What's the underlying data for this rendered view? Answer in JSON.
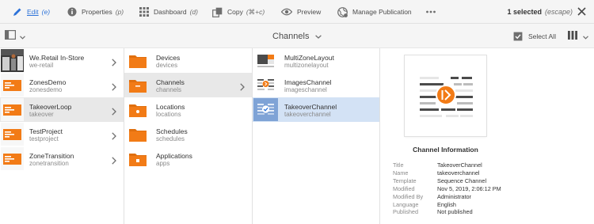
{
  "toolbar": {
    "edit": {
      "label": "Edit",
      "shortcut": "(e)"
    },
    "properties": {
      "label": "Properties",
      "shortcut": "(p)"
    },
    "dashboard": {
      "label": "Dashboard",
      "shortcut": "(d)"
    },
    "copy": {
      "label": "Copy",
      "shortcut": "(⌘+c)"
    },
    "preview": {
      "label": "Preview"
    },
    "manage_publication": {
      "label": "Manage Publication"
    },
    "more_icon": "ellipsis-icon",
    "selection": {
      "label": "1 selected",
      "shortcut": "(escape)"
    },
    "accent": "#2c72d9"
  },
  "subbar": {
    "breadcrumb": "Channels",
    "select_all": "Select All"
  },
  "columns": {
    "projects": [
      {
        "title": "We.Retail In-Store",
        "name": "we-retail"
      },
      {
        "title": "ZonesDemo",
        "name": "zonesdemo"
      },
      {
        "title": "TakeoverLoop",
        "name": "takeover"
      },
      {
        "title": "TestProject",
        "name": "testproject"
      },
      {
        "title": "ZoneTransition",
        "name": "zonetransition"
      }
    ],
    "folders": [
      {
        "title": "Devices",
        "name": "devices"
      },
      {
        "title": "Channels",
        "name": "channels"
      },
      {
        "title": "Locations",
        "name": "locations"
      },
      {
        "title": "Schedules",
        "name": "schedules"
      },
      {
        "title": "Applications",
        "name": "apps"
      }
    ],
    "channels": [
      {
        "title": "MultiZoneLayout",
        "name": "multizonelayout"
      },
      {
        "title": "ImagesChannel",
        "name": "imageschannel"
      },
      {
        "title": "TakeoverChannel",
        "name": "takeoverchannel"
      }
    ]
  },
  "preview": {
    "heading": "Channel Information",
    "fields": [
      {
        "key": "Title",
        "value": "TakeoverChannel"
      },
      {
        "key": "Name",
        "value": "takeoverchannel"
      },
      {
        "key": "Template",
        "value": "Sequence Channel"
      },
      {
        "key": "Modified",
        "value": "Nov 5, 2019, 2:06:12 PM"
      },
      {
        "key": "Modified By",
        "value": "Administrator"
      },
      {
        "key": "Language",
        "value": "English"
      },
      {
        "key": "Published",
        "value": "Not published"
      }
    ],
    "play_color": "#f27b16"
  }
}
